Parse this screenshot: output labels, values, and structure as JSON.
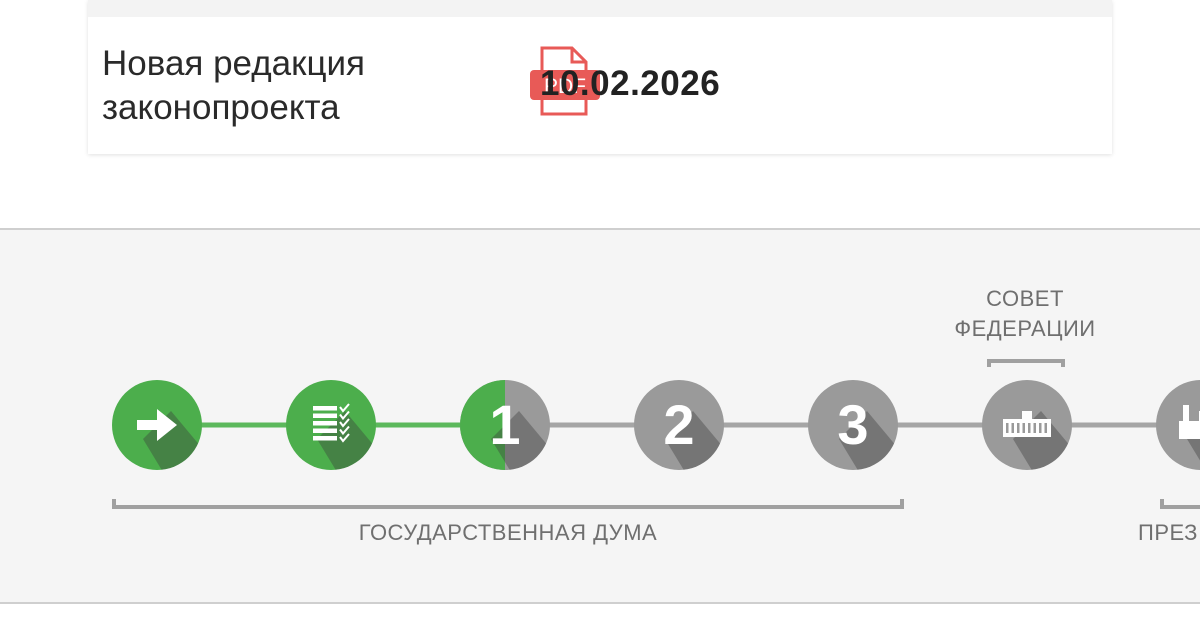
{
  "document": {
    "title": "Новая редакция законопроекта",
    "file_type": "PDF",
    "date": "10.02.2026",
    "icon": "pdf-file-icon",
    "icon_color": "#e85a57"
  },
  "tracker": {
    "colors": {
      "completed": "#4cae4c",
      "completed_line": "#5cb85c",
      "pending": "#9a9a9a",
      "pending_line": "#a5a5a5",
      "shadow": "#3a3a3a"
    },
    "steps": [
      {
        "id": "submitted",
        "icon": "arrow-right-icon",
        "label": "",
        "state": "completed"
      },
      {
        "id": "preliminary",
        "icon": "checklist-icon",
        "label": "",
        "state": "completed"
      },
      {
        "id": "reading-1",
        "icon": "",
        "label": "1",
        "state": "partial"
      },
      {
        "id": "reading-2",
        "icon": "",
        "label": "2",
        "state": "pending"
      },
      {
        "id": "reading-3",
        "icon": "",
        "label": "3",
        "state": "pending"
      },
      {
        "id": "federation-council",
        "icon": "federation-council-building-icon",
        "label": "",
        "state": "pending"
      },
      {
        "id": "president",
        "icon": "factory-building-icon",
        "label": "",
        "state": "pending"
      }
    ],
    "labels": {
      "federation_council_line1": "СОВЕТ",
      "federation_council_line2": "ФЕДЕРАЦИИ",
      "state_duma": "ГОСУДАРСТВЕННАЯ ДУМА",
      "president_partial": "ПРЕЗ"
    }
  }
}
